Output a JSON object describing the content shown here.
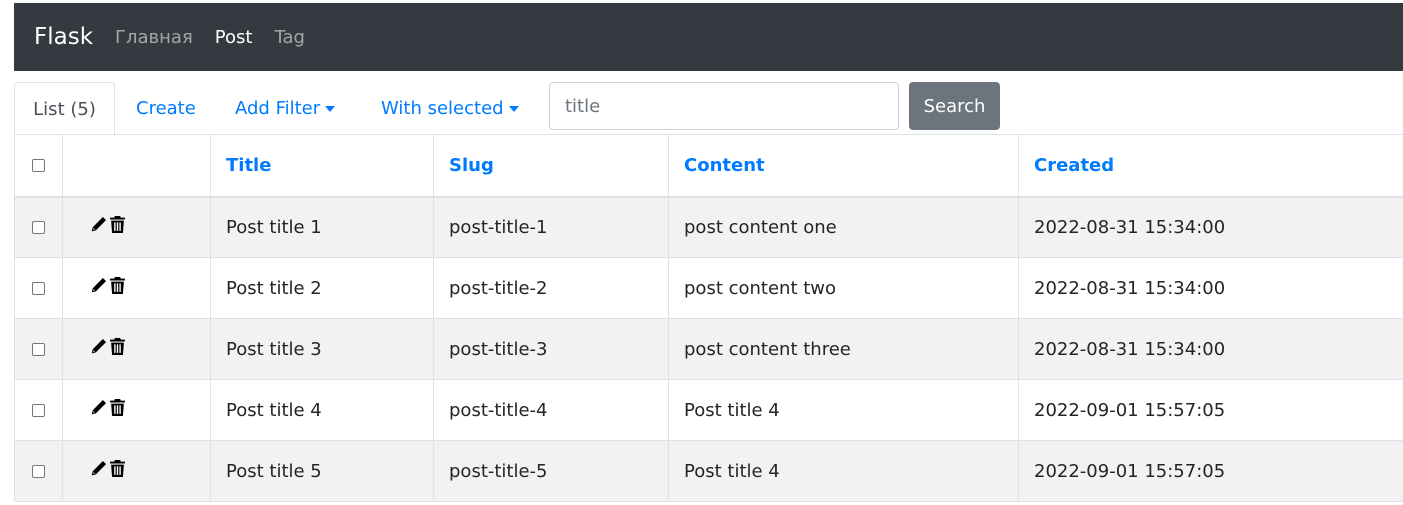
{
  "navbar": {
    "brand": "Flask",
    "links": [
      {
        "label": "Главная",
        "active": false
      },
      {
        "label": "Post",
        "active": true
      },
      {
        "label": "Tag",
        "active": false
      }
    ]
  },
  "tabs": {
    "list": "List (5)",
    "create": "Create",
    "add_filter": "Add Filter",
    "with_selected": "With selected"
  },
  "search": {
    "placeholder": "title",
    "button": "Search"
  },
  "table": {
    "columns": [
      "Title",
      "Slug",
      "Content",
      "Created"
    ],
    "rows": [
      {
        "title": "Post title 1",
        "slug": "post-title-1",
        "content": "post content one",
        "created": "2022-08-31 15:34:00"
      },
      {
        "title": "Post title 2",
        "slug": "post-title-2",
        "content": "post content two",
        "created": "2022-08-31 15:34:00"
      },
      {
        "title": "Post title 3",
        "slug": "post-title-3",
        "content": "post content three",
        "created": "2022-08-31 15:34:00"
      },
      {
        "title": "Post title 4",
        "slug": "post-title-4",
        "content": "Post title 4",
        "created": "2022-09-01 15:57:05"
      },
      {
        "title": "Post title 5",
        "slug": "post-title-5",
        "content": "Post title 4",
        "created": "2022-09-01 15:57:05"
      }
    ]
  },
  "icons": {
    "edit": "pencil-icon",
    "delete": "trash-icon"
  },
  "colors": {
    "navbar_bg": "#343a40",
    "link": "#007bff",
    "search_button": "#6c757d",
    "stripe": "#f2f2f2"
  }
}
